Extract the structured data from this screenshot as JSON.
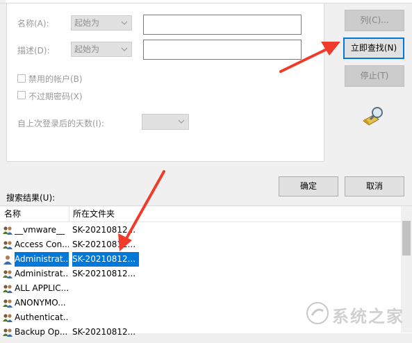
{
  "form": {
    "name_label": "名称(A):",
    "name_mode": "起始为",
    "desc_label": "描述(D):",
    "desc_mode": "起始为",
    "disabled_accounts": "禁用的帐户(B)",
    "no_expire_pwd": "不过期密码(X)",
    "days_since_logon": "自上次登录后的天数(I):"
  },
  "buttons": {
    "columns": "列(C)...",
    "find_now": "立即查找(N)",
    "stop": "停止(T)",
    "ok": "确定",
    "cancel": "取消"
  },
  "results": {
    "label": "搜索结果(U):",
    "col_name": "名称",
    "col_folder": "所在文件夹",
    "rows": [
      {
        "name": "__vmware__",
        "folder": "SK-20210812...",
        "icon": "group-icon"
      },
      {
        "name": "Access Con...",
        "folder": "SK-20210812...",
        "icon": "group-icon"
      },
      {
        "name": "Administrat...",
        "folder": "SK-20210812...",
        "icon": "user-icon",
        "selected": true
      },
      {
        "name": "Administrat...",
        "folder": "SK-20210812...",
        "icon": "group-icon"
      },
      {
        "name": "ALL APPLIC...",
        "folder": "",
        "icon": "group-icon"
      },
      {
        "name": "ANONYMO...",
        "folder": "",
        "icon": "group-icon"
      },
      {
        "name": "Authenticat...",
        "folder": "",
        "icon": "group-icon"
      },
      {
        "name": "Backup Op...",
        "folder": "SK-20210812...",
        "icon": "group-icon"
      }
    ]
  },
  "watermark": "系统之家",
  "colors": {
    "accent": "#0078d7",
    "arrow": "#f03b2b"
  }
}
